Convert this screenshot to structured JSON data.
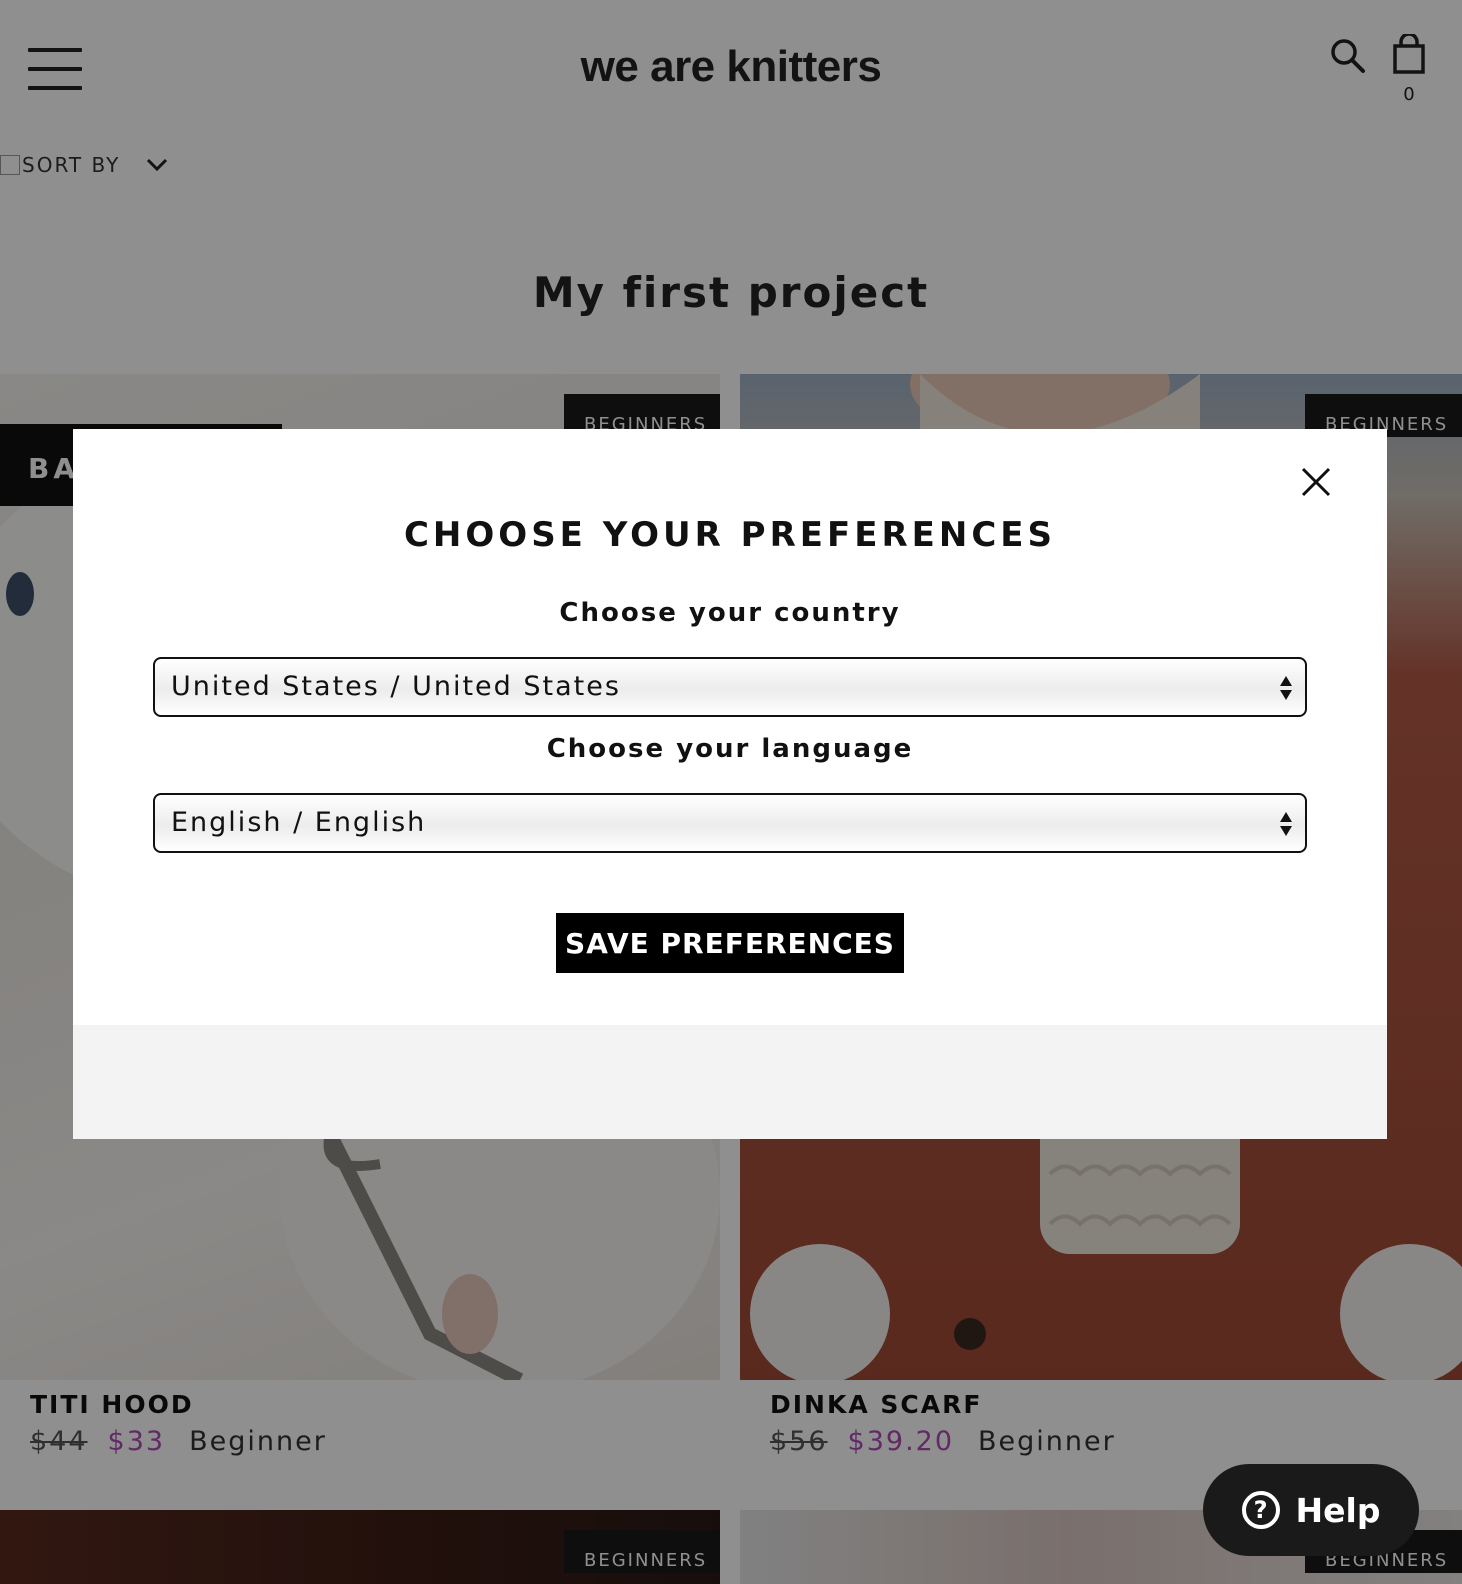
{
  "header": {
    "logo": "we are knitters",
    "cart_count": "0"
  },
  "toolbar": {
    "sort_label": "SORT BY"
  },
  "page": {
    "title": "My first project"
  },
  "products": [
    {
      "name": "TITI HOOD",
      "old_price": "$44",
      "new_price": "$33",
      "level": "Beginner",
      "badge": "BEGINNERS",
      "sale_tag": "BA"
    },
    {
      "name": "DINKA SCARF",
      "old_price": "$56",
      "new_price": "$39.20",
      "level": "Beginner",
      "badge": "BEGINNERS"
    },
    {
      "badge": "BEGINNERS"
    },
    {
      "badge": "BEGINNERS"
    }
  ],
  "help": {
    "label": "Help",
    "icon_glyph": "?"
  },
  "modal": {
    "title": "CHOOSE YOUR PREFERENCES",
    "country_label": "Choose your country",
    "country_value": "United States / United States",
    "language_label": "Choose your language",
    "language_value": "English / English",
    "save_label": "SAVE PREFERENCES"
  },
  "colors": {
    "sale_price": "#b04ab8",
    "overlay": "rgba(0,0,0,0.44)"
  }
}
